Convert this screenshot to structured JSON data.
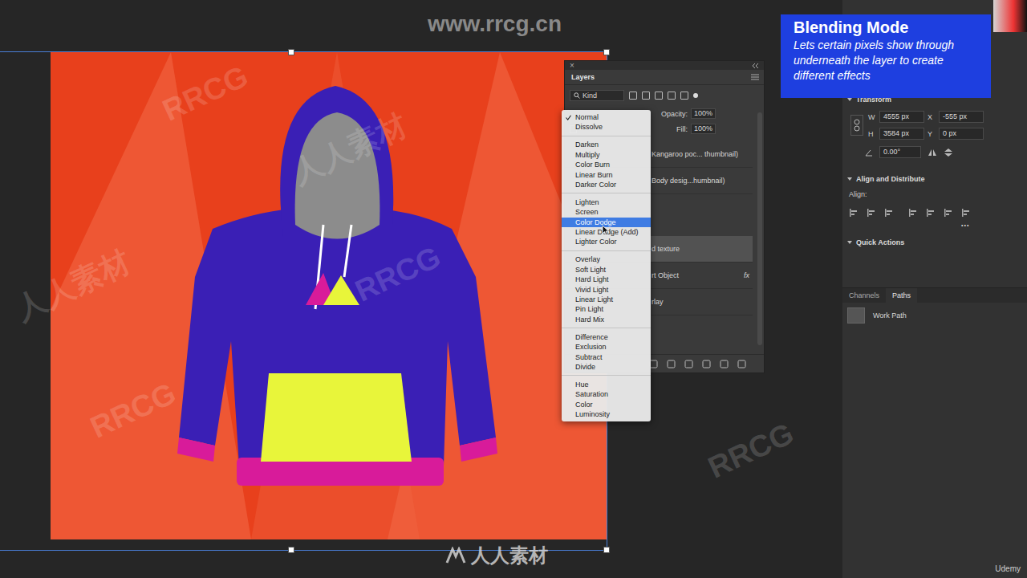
{
  "watermarks": {
    "site": "www.rrcg.cn",
    "brand": "人人素材",
    "platform": "Udemy",
    "tiles": [
      "RRCG",
      "人人素材",
      "RRCG",
      "人人素材",
      "RRCG",
      "RRCG"
    ]
  },
  "callout": {
    "title": "Blending Mode",
    "text": "Lets certain pixels show through underneath the layer to create different effects"
  },
  "layers_panel": {
    "title": "Layers",
    "close": "×",
    "filter": "Kind",
    "opacity_label": "Opacity:",
    "opacity": "100%",
    "fill_label": "Fill:",
    "fill": "100%",
    "layers": [
      {
        "name": "Kangaroo poc... thumbnail)",
        "fx": "",
        "selected": false
      },
      {
        "name": "Body desig...humbnail)",
        "fx": "",
        "selected": false
      },
      {
        "name": "d texture",
        "fx": "",
        "selected": true
      },
      {
        "name": "rt Object",
        "fx": "fx",
        "selected": false
      },
      {
        "name": "rlay",
        "fx": "",
        "selected": false
      }
    ]
  },
  "blend_menu": {
    "groups": [
      [
        {
          "label": "Normal",
          "checked": true,
          "selected": false
        },
        {
          "label": "Dissolve",
          "checked": false,
          "selected": false
        }
      ],
      [
        {
          "label": "Darken",
          "checked": false,
          "selected": false
        },
        {
          "label": "Multiply",
          "checked": false,
          "selected": false
        },
        {
          "label": "Color Burn",
          "checked": false,
          "selected": false
        },
        {
          "label": "Linear Burn",
          "checked": false,
          "selected": false
        },
        {
          "label": "Darker Color",
          "checked": false,
          "selected": false
        }
      ],
      [
        {
          "label": "Lighten",
          "checked": false,
          "selected": false
        },
        {
          "label": "Screen",
          "checked": false,
          "selected": false
        },
        {
          "label": "Color Dodge",
          "checked": false,
          "selected": true
        },
        {
          "label": "Linear Dodge (Add)",
          "checked": false,
          "selected": false
        },
        {
          "label": "Lighter Color",
          "checked": false,
          "selected": false
        }
      ],
      [
        {
          "label": "Overlay",
          "checked": false,
          "selected": false
        },
        {
          "label": "Soft Light",
          "checked": false,
          "selected": false
        },
        {
          "label": "Hard Light",
          "checked": false,
          "selected": false
        },
        {
          "label": "Vivid Light",
          "checked": false,
          "selected": false
        },
        {
          "label": "Linear Light",
          "checked": false,
          "selected": false
        },
        {
          "label": "Pin Light",
          "checked": false,
          "selected": false
        },
        {
          "label": "Hard Mix",
          "checked": false,
          "selected": false
        }
      ],
      [
        {
          "label": "Difference",
          "checked": false,
          "selected": false
        },
        {
          "label": "Exclusion",
          "checked": false,
          "selected": false
        },
        {
          "label": "Subtract",
          "checked": false,
          "selected": false
        },
        {
          "label": "Divide",
          "checked": false,
          "selected": false
        }
      ],
      [
        {
          "label": "Hue",
          "checked": false,
          "selected": false
        },
        {
          "label": "Saturation",
          "checked": false,
          "selected": false
        },
        {
          "label": "Color",
          "checked": false,
          "selected": false
        },
        {
          "label": "Luminosity",
          "checked": false,
          "selected": false
        }
      ]
    ]
  },
  "properties": {
    "transform": {
      "title": "Transform",
      "w": {
        "label": "W",
        "value": "4555 px"
      },
      "x": {
        "label": "X",
        "value": "-555 px"
      },
      "h": {
        "label": "H",
        "value": "3584 px"
      },
      "y": {
        "label": "Y",
        "value": "0 px"
      },
      "angle": "0.00°"
    },
    "align": {
      "title": "Align and Distribute",
      "label": "Align:",
      "more": "•••"
    },
    "quick_actions": {
      "title": "Quick Actions"
    }
  },
  "bottom_panel": {
    "tabs": [
      {
        "label": "Channels",
        "selected": false
      },
      {
        "label": "Paths",
        "selected": true
      }
    ],
    "paths": [
      {
        "name": "Work Path",
        "selected": false
      }
    ]
  }
}
